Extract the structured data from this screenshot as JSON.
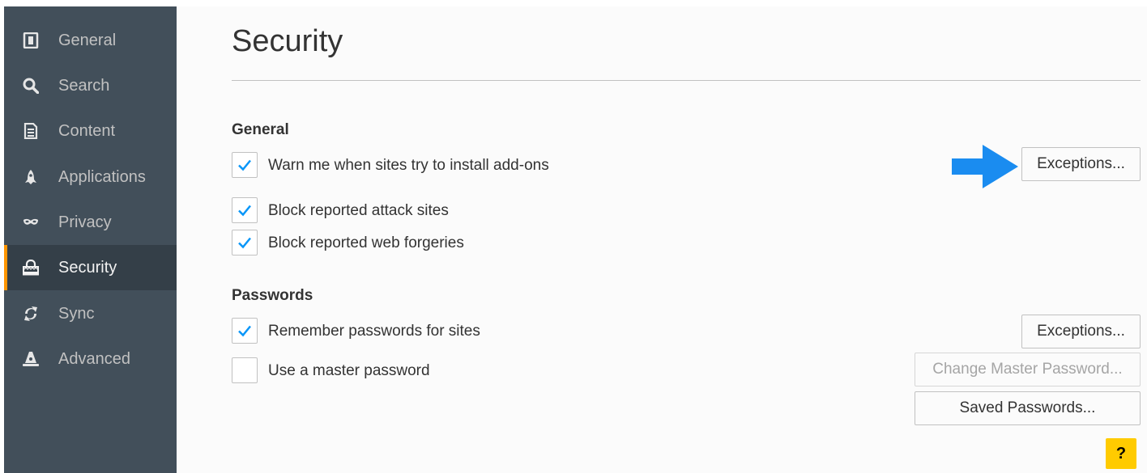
{
  "sidebar": {
    "items": [
      {
        "label": "General",
        "icon": "general-icon"
      },
      {
        "label": "Search",
        "icon": "search-icon"
      },
      {
        "label": "Content",
        "icon": "content-icon"
      },
      {
        "label": "Applications",
        "icon": "applications-icon"
      },
      {
        "label": "Privacy",
        "icon": "privacy-mask-icon"
      },
      {
        "label": "Security",
        "icon": "security-lock-icon",
        "selected": true
      },
      {
        "label": "Sync",
        "icon": "sync-icon"
      },
      {
        "label": "Advanced",
        "icon": "advanced-icon"
      }
    ]
  },
  "main": {
    "title": "Security",
    "general": {
      "heading": "General",
      "warn_addons": {
        "label": "Warn me when sites try to install add-ons",
        "checked": true
      },
      "block_attack": {
        "label": "Block reported attack sites",
        "checked": true
      },
      "block_forgeries": {
        "label": "Block reported web forgeries",
        "checked": true
      },
      "exceptions_label": "Exceptions..."
    },
    "passwords": {
      "heading": "Passwords",
      "remember": {
        "label": "Remember passwords for sites",
        "checked": true
      },
      "master": {
        "label": "Use a master password",
        "checked": false
      },
      "exceptions_label": "Exceptions...",
      "change_master_label": "Change Master Password...",
      "saved_passwords_label": "Saved Passwords..."
    },
    "help_label": "?"
  },
  "colors": {
    "sidebar_bg": "#424f5a",
    "sidebar_selected_bg": "#343f48",
    "selected_accent": "#ff9500",
    "check_color": "#0996f8",
    "arrow_color": "#1a8cf0",
    "help_bg": "#ffcb00"
  }
}
